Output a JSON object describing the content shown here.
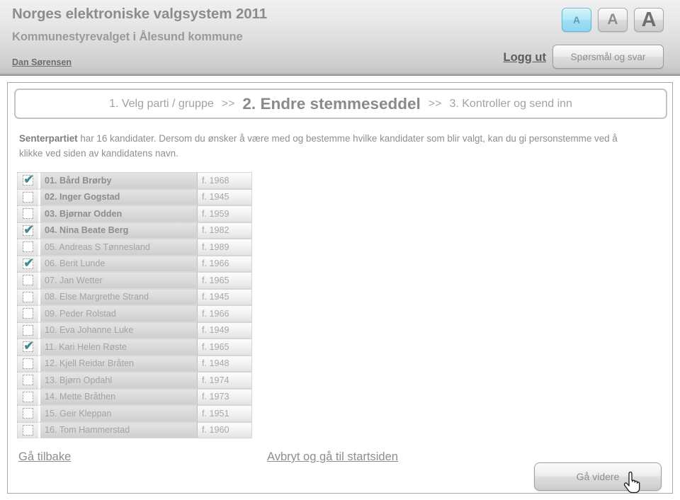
{
  "header": {
    "title": "Norges elektroniske valgsystem 2011",
    "subtitle": "Kommunestyrevalget i Ålesund kommune",
    "user": "Dan Sørensen",
    "logout": "Logg ut",
    "faq_button": "Spørsmål og svar",
    "font_sizes": [
      {
        "label": "A",
        "selected": true
      },
      {
        "label": "A",
        "selected": false
      },
      {
        "label": "A",
        "selected": false
      }
    ],
    "selected_accent": "#8ed6ef"
  },
  "steps": {
    "separator": ">>",
    "items": [
      {
        "label": "1. Velg parti / gruppe",
        "active": false
      },
      {
        "label": "2. Endre stemmeseddel",
        "active": true
      },
      {
        "label": "3. Kontroller og send inn",
        "active": false
      }
    ]
  },
  "intro": {
    "party": "Senterpartiet",
    "text": " har 16 kandidater. Dersom du ønsker å være med og bestemme hvilke kandidater som blir valgt, kan du gi personstemme  ved å klikke ved siden av kandidatens navn."
  },
  "candidates": {
    "checkmark_glyph": "✔",
    "checkmark_color": "#3f8a8f",
    "rows": [
      {
        "name": "01. Bård Brørby",
        "year": "f. 1968",
        "checked": true,
        "bold": true
      },
      {
        "name": "02. Inger Gogstad",
        "year": "f. 1945",
        "checked": false,
        "bold": true
      },
      {
        "name": "03. Bjørnar Odden",
        "year": "f. 1959",
        "checked": false,
        "bold": true
      },
      {
        "name": "04. Nina Beate Berg",
        "year": "f. 1982",
        "checked": true,
        "bold": true
      },
      {
        "name": "05. Andreas S Tønnesland",
        "year": "f. 1989",
        "checked": false,
        "bold": false
      },
      {
        "name": "06. Berit Lunde",
        "year": "f. 1966",
        "checked": true,
        "bold": false
      },
      {
        "name": "07. Jan Wetter",
        "year": "f. 1965",
        "checked": false,
        "bold": false
      },
      {
        "name": "08. Else Margrethe Strand",
        "year": "f. 1945",
        "checked": false,
        "bold": false
      },
      {
        "name": "09. Peder Rolstad",
        "year": "f. 1966",
        "checked": false,
        "bold": false
      },
      {
        "name": "10. Eva Johanne Luke",
        "year": "f. 1949",
        "checked": false,
        "bold": false
      },
      {
        "name": "11. Kari Helen Røste",
        "year": "f. 1965",
        "checked": true,
        "bold": false
      },
      {
        "name": "12. Kjell Reidar Bråten",
        "year": "f. 1948",
        "checked": false,
        "bold": false
      },
      {
        "name": "13. Bjørn Opdahl",
        "year": "f. 1974",
        "checked": false,
        "bold": false
      },
      {
        "name": "14. Mette Bråthen",
        "year": "f. 1973",
        "checked": false,
        "bold": false
      },
      {
        "name": "15. Geir Kleppan",
        "year": "f. 1951",
        "checked": false,
        "bold": false
      },
      {
        "name": "16. Tom Hammerstad",
        "year": "f. 1960",
        "checked": false,
        "bold": false
      }
    ]
  },
  "footer": {
    "back": "Gå tilbake",
    "cancel": "Avbryt og gå til startsiden",
    "next": "Gå videre"
  }
}
